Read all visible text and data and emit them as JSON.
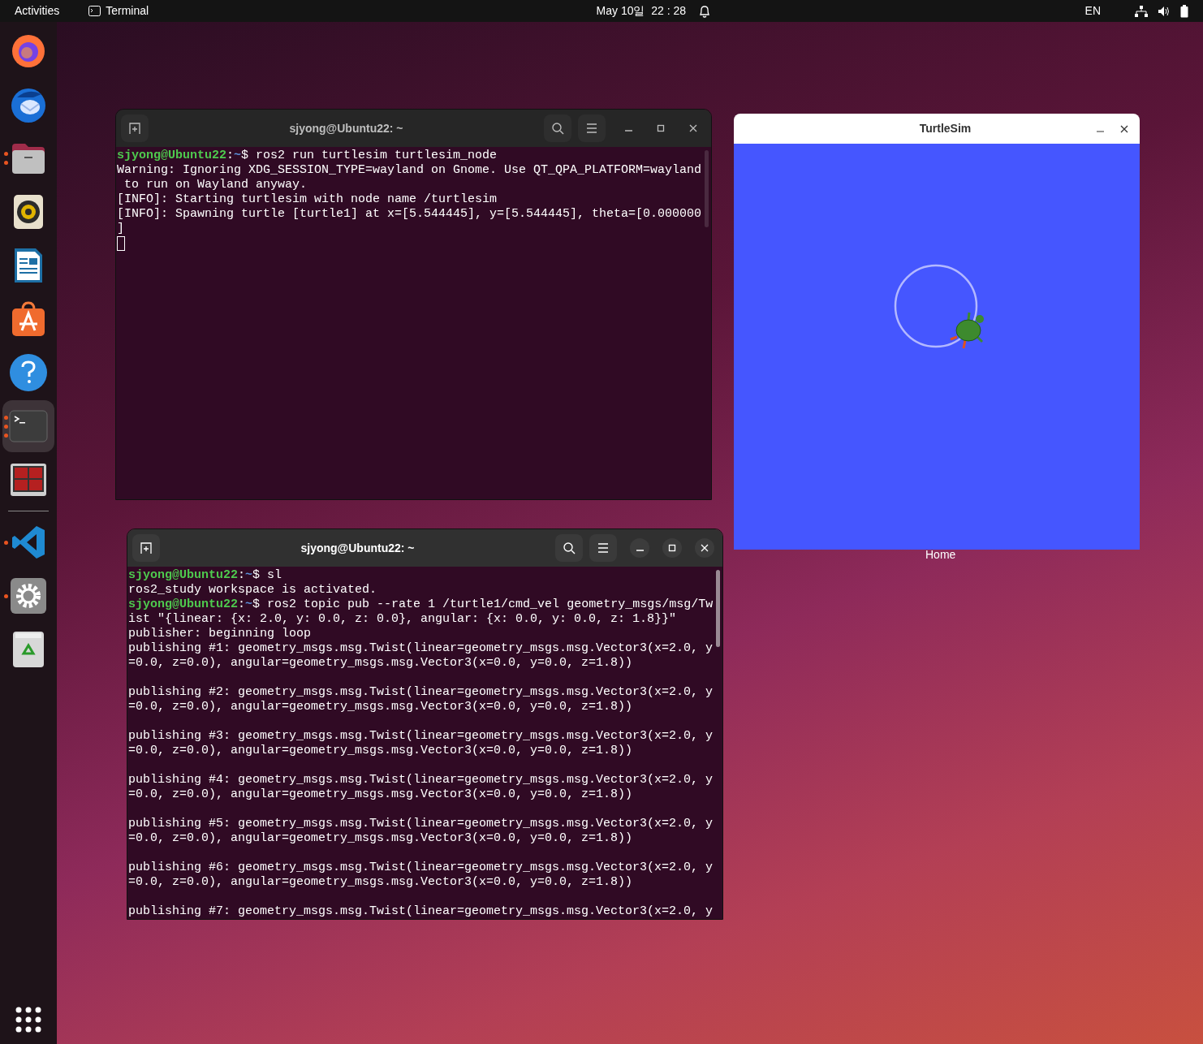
{
  "top_bar": {
    "activities": "Activities",
    "app_name": "Terminal",
    "clock": "May 10일  22 : 28",
    "keyboard_layout": "EN"
  },
  "dock": {
    "favorites": [
      {
        "kind": "firefox",
        "selected": false
      },
      {
        "kind": "thunderbird",
        "selected": false
      },
      {
        "kind": "files",
        "selected": false,
        "indicators": [
          {
            "kind": "dot"
          },
          {
            "kind": "dot"
          }
        ]
      },
      {
        "kind": "rhythmbox",
        "selected": false
      },
      {
        "kind": "writer",
        "selected": false
      },
      {
        "kind": "appstore",
        "selected": false
      },
      {
        "kind": "help",
        "selected": false
      },
      {
        "kind": "terminal",
        "selected": true,
        "indicators": [
          {
            "kind": "dot"
          },
          {
            "kind": "dot"
          },
          {
            "kind": "dot"
          }
        ]
      },
      {
        "kind": "multiterm",
        "selected": false
      }
    ],
    "others": [
      {
        "kind": "vscode",
        "selected": false,
        "indicators": [
          {
            "kind": "dot"
          }
        ]
      },
      {
        "kind": "settings",
        "selected": false,
        "indicators": [
          {
            "kind": "dot"
          }
        ]
      },
      {
        "kind": "trash",
        "selected": false
      }
    ]
  },
  "desktop": {
    "home_label": "Home"
  },
  "terminals": [
    {
      "title": "sjyong@Ubuntu22: ~",
      "focused": false,
      "lines": [
        {
          "kind": "prompt",
          "user": "sjyong@Ubuntu22",
          "sep": ":",
          "path": "~",
          "command": "$ ros2 run turtlesim turtlesim_node"
        },
        {
          "kind": "output",
          "text": "Warning: Ignoring XDG_SESSION_TYPE=wayland on Gnome. Use QT_QPA_PLATFORM=wayland"
        },
        {
          "kind": "output",
          "text": " to run on Wayland anyway."
        },
        {
          "kind": "output",
          "text": "[INFO]: Starting turtlesim with node name /turtlesim"
        },
        {
          "kind": "output",
          "text": "[INFO]: Spawning turtle [turtle1] at x=[5.544445], y=[5.544445], theta=[0.000000"
        },
        {
          "kind": "output",
          "text": "]"
        },
        {
          "kind": "cursor"
        }
      ]
    },
    {
      "title": "sjyong@Ubuntu22: ~",
      "focused": true,
      "lines": [
        {
          "kind": "prompt",
          "user": "sjyong@Ubuntu22",
          "sep": ":",
          "path": "~",
          "command": "$ sl"
        },
        {
          "kind": "output",
          "text": "ros2_study workspace is activated."
        },
        {
          "kind": "prompt",
          "user": "sjyong@Ubuntu22",
          "sep": ":",
          "path": "~",
          "command": "$ ros2 topic pub --rate 1 /turtle1/cmd_vel geometry_msgs/msg/Tw"
        },
        {
          "kind": "output",
          "text": "ist \"{linear: {x: 2.0, y: 0.0, z: 0.0}, angular: {x: 0.0, y: 0.0, z: 1.8}}\""
        },
        {
          "kind": "output",
          "text": "publisher: beginning loop"
        },
        {
          "kind": "output",
          "text": "publishing #1: geometry_msgs.msg.Twist(linear=geometry_msgs.msg.Vector3(x=2.0, y"
        },
        {
          "kind": "output",
          "text": "=0.0, z=0.0), angular=geometry_msgs.msg.Vector3(x=0.0, y=0.0, z=1.8))"
        },
        {
          "kind": "blank"
        },
        {
          "kind": "output",
          "text": "publishing #2: geometry_msgs.msg.Twist(linear=geometry_msgs.msg.Vector3(x=2.0, y"
        },
        {
          "kind": "output",
          "text": "=0.0, z=0.0), angular=geometry_msgs.msg.Vector3(x=0.0, y=0.0, z=1.8))"
        },
        {
          "kind": "blank"
        },
        {
          "kind": "output",
          "text": "publishing #3: geometry_msgs.msg.Twist(linear=geometry_msgs.msg.Vector3(x=2.0, y"
        },
        {
          "kind": "output",
          "text": "=0.0, z=0.0), angular=geometry_msgs.msg.Vector3(x=0.0, y=0.0, z=1.8))"
        },
        {
          "kind": "blank"
        },
        {
          "kind": "output",
          "text": "publishing #4: geometry_msgs.msg.Twist(linear=geometry_msgs.msg.Vector3(x=2.0, y"
        },
        {
          "kind": "output",
          "text": "=0.0, z=0.0), angular=geometry_msgs.msg.Vector3(x=0.0, y=0.0, z=1.8))"
        },
        {
          "kind": "blank"
        },
        {
          "kind": "output",
          "text": "publishing #5: geometry_msgs.msg.Twist(linear=geometry_msgs.msg.Vector3(x=2.0, y"
        },
        {
          "kind": "output",
          "text": "=0.0, z=0.0), angular=geometry_msgs.msg.Vector3(x=0.0, y=0.0, z=1.8))"
        },
        {
          "kind": "blank"
        },
        {
          "kind": "output",
          "text": "publishing #6: geometry_msgs.msg.Twist(linear=geometry_msgs.msg.Vector3(x=2.0, y"
        },
        {
          "kind": "output",
          "text": "=0.0, z=0.0), angular=geometry_msgs.msg.Vector3(x=0.0, y=0.0, z=1.8))"
        },
        {
          "kind": "blank"
        },
        {
          "kind": "output",
          "text": "publishing #7: geometry_msgs.msg.Twist(linear=geometry_msgs.msg.Vector3(x=2.0, y"
        }
      ]
    }
  ],
  "turtlesim": {
    "title": "TurtleSim"
  }
}
